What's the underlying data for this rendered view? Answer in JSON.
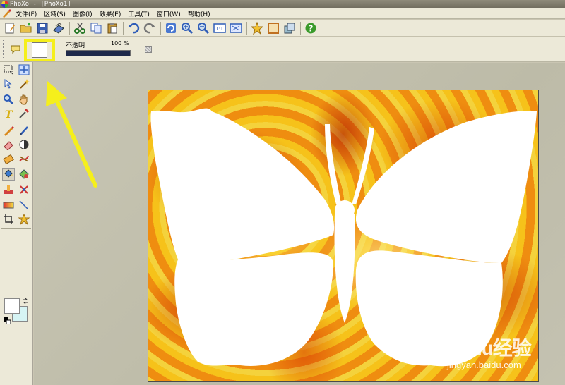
{
  "window": {
    "title": "PhoXo - [PhoXo1]"
  },
  "menu": {
    "items": [
      "文件(F)",
      "区域(S)",
      "图像(I)",
      "效果(E)",
      "工具(T)",
      "窗口(W)",
      "帮助(H)"
    ]
  },
  "toolbar": {
    "buttons": [
      "new-icon",
      "open-icon",
      "save-icon",
      "scan-icon",
      "cut-icon",
      "copy-icon",
      "paste-icon",
      "undo-icon",
      "redo-icon",
      "refresh-icon",
      "zoom-in-icon",
      "zoom-out-icon",
      "actual-size-icon",
      "fit-window-icon",
      "favorite-icon",
      "frame-icon",
      "layers-icon",
      "help-icon"
    ]
  },
  "options": {
    "opacity_label": "不透明",
    "opacity_value": "100 %",
    "opacity_fraction": 1.0
  },
  "palette": {
    "tools": [
      "rect-select-icon",
      "move-icon",
      "lasso-icon",
      "magic-wand-icon",
      "zoom-tool-icon",
      "hand-icon",
      "text-tool-icon",
      "eyedropper-icon",
      "pencil-icon",
      "brush-icon",
      "eraser-icon",
      "dodge-icon",
      "clone-icon",
      "smudge-icon",
      "fill-icon",
      "shape-icon",
      "stamp-icon",
      "color-replace-icon",
      "gradient-icon",
      "line-icon",
      "crop-icon",
      "star-icon"
    ],
    "foreground_color": "#ffffff",
    "background_color": "#d6f4f4"
  },
  "watermark": {
    "main": "Baidu经验",
    "sub": "jingyan.baidu.com"
  },
  "colors": {
    "highlight": "#f5ef1c",
    "arrow": "#f5ef1c",
    "opacity_bar": "#1f2a4a"
  }
}
